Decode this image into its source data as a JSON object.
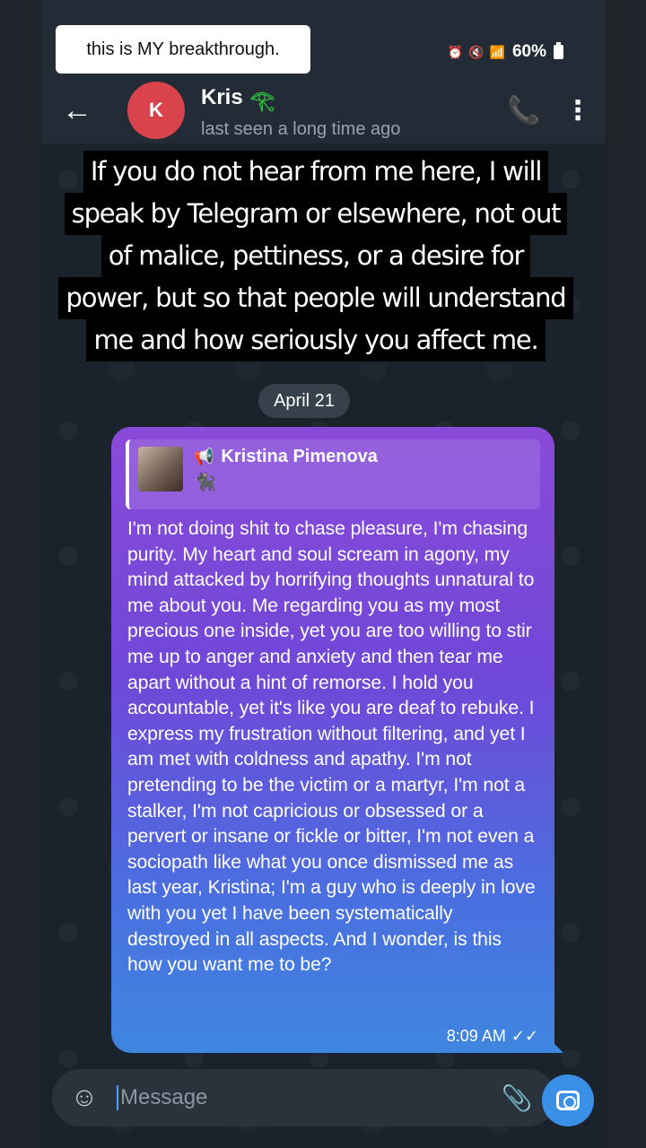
{
  "caption_chip": "this is MY breakthrough.",
  "status": {
    "battery": "60%"
  },
  "header": {
    "avatar_letter": "K",
    "contact_name": "Kris",
    "last_seen": "last seen a long time ago"
  },
  "overlay_caption": {
    "lines": [
      "If you do not hear from me here, I will",
      "speak by Telegram or elsewhere, not out",
      "of malice, pettiness, or a desire for",
      "power, but so that people will understand",
      "me and how seriously you affect me."
    ]
  },
  "chat": {
    "date": "April 21",
    "message": {
      "reply_author": "Kristina Pimenova",
      "reply_emoji": "🐈‍⬛",
      "text": "I'm not doing shit to chase pleasure, I'm chasing purity. My heart and soul scream in agony, my mind attacked by horrifying thoughts unnatural to me about you. Me regarding you as my most precious one inside, yet you are too willing to stir me up to anger and anxiety and then tear me apart without a hint of remorse. I hold you accountable, yet it's like you are deaf to rebuke. I express my frustration without filtering, and yet I am met with coldness and apathy. I'm not pretending to be the victim or a martyr, I'm not a stalker, I'm not capricious or obsessed or a pervert or insane or fickle or bitter, I'm not even a sociopath like what you once dismissed me as last year, Kristina; I'm a guy who is deeply in love with you yet I have been systematically destroyed in all aspects. And I wonder, is this how you want me to be?",
      "time": "8:09 AM",
      "ticks": "✓✓"
    }
  },
  "input": {
    "placeholder": "Message"
  }
}
